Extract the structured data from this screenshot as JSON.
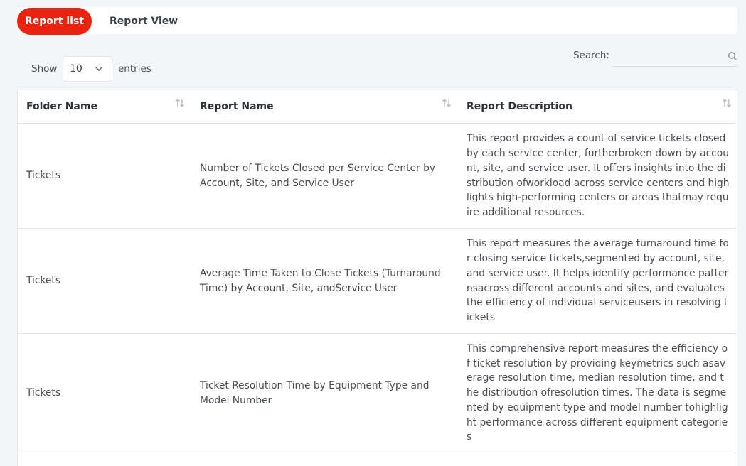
{
  "tabs": [
    {
      "label": "Report list",
      "active": true
    },
    {
      "label": "Report View",
      "active": false
    }
  ],
  "controls": {
    "show_label": "Show",
    "entries_value": "10",
    "entries_label": "entries",
    "search_label": "Search:",
    "search_value": "",
    "search_icon": "search-icon"
  },
  "colors": {
    "accent": "#e8230f",
    "background": "#f4f5f7"
  },
  "table": {
    "columns": [
      "Folder Name",
      "Report Name",
      "Report Description"
    ],
    "rows": [
      {
        "folder": "Tickets",
        "name": "Number of Tickets Closed per Service Center by Account, Site, and Service User",
        "description": "This report provides a count of service tickets closed by each service center, furtherbroken down by account, site, and service user. It offers insights into the distribution ofworkload across service centers and highlights high-performing centers or areas thatmay require additional resources."
      },
      {
        "folder": "Tickets",
        "name": "Average Time Taken to Close Tickets (Turnaround Time) by Account, Site, andService User",
        "description": "This report measures the average turnaround time for closing service tickets,segmented by account, site, and service user. It helps identify performance patternsacross different accounts and sites, and evaluates the efficiency of individual serviceusers in resolving tickets"
      },
      {
        "folder": "Tickets",
        "name": "Ticket Resolution Time by Equipment Type and Model Number",
        "description": "This comprehensive report measures the efficiency of ticket resolution by providing keymetrics such asaverage resolution time, median resolution time, and the distribution ofresolution times. The data is segmented by equipment type and model number tohighlight performance across different equipment categories"
      }
    ]
  }
}
